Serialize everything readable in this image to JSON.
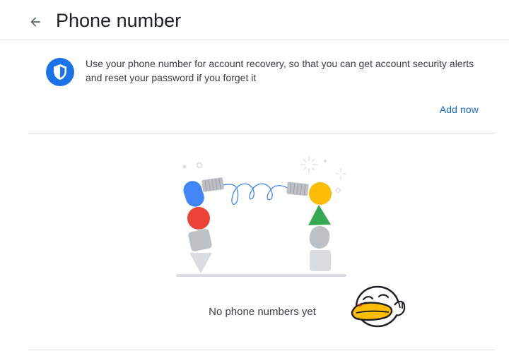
{
  "header": {
    "title": "Phone number",
    "back_icon": "arrow-back-icon"
  },
  "info": {
    "icon": "shield-icon",
    "description": "Use your phone number for account recovery, so that you can get account security alerts and reset your password if you forget it",
    "add_now_label": "Add now"
  },
  "empty_state": {
    "message": "No phone numbers yet",
    "illustration": "robot-arms-phone-cord-illustration",
    "sticker": "smiling-duck-sticker"
  },
  "colors": {
    "accent_blue": "#1a73e8",
    "google_blue": "#4285f4",
    "google_red": "#ea4335",
    "google_yellow": "#fbbc04",
    "google_green": "#34a853",
    "divider": "#dadce0"
  }
}
